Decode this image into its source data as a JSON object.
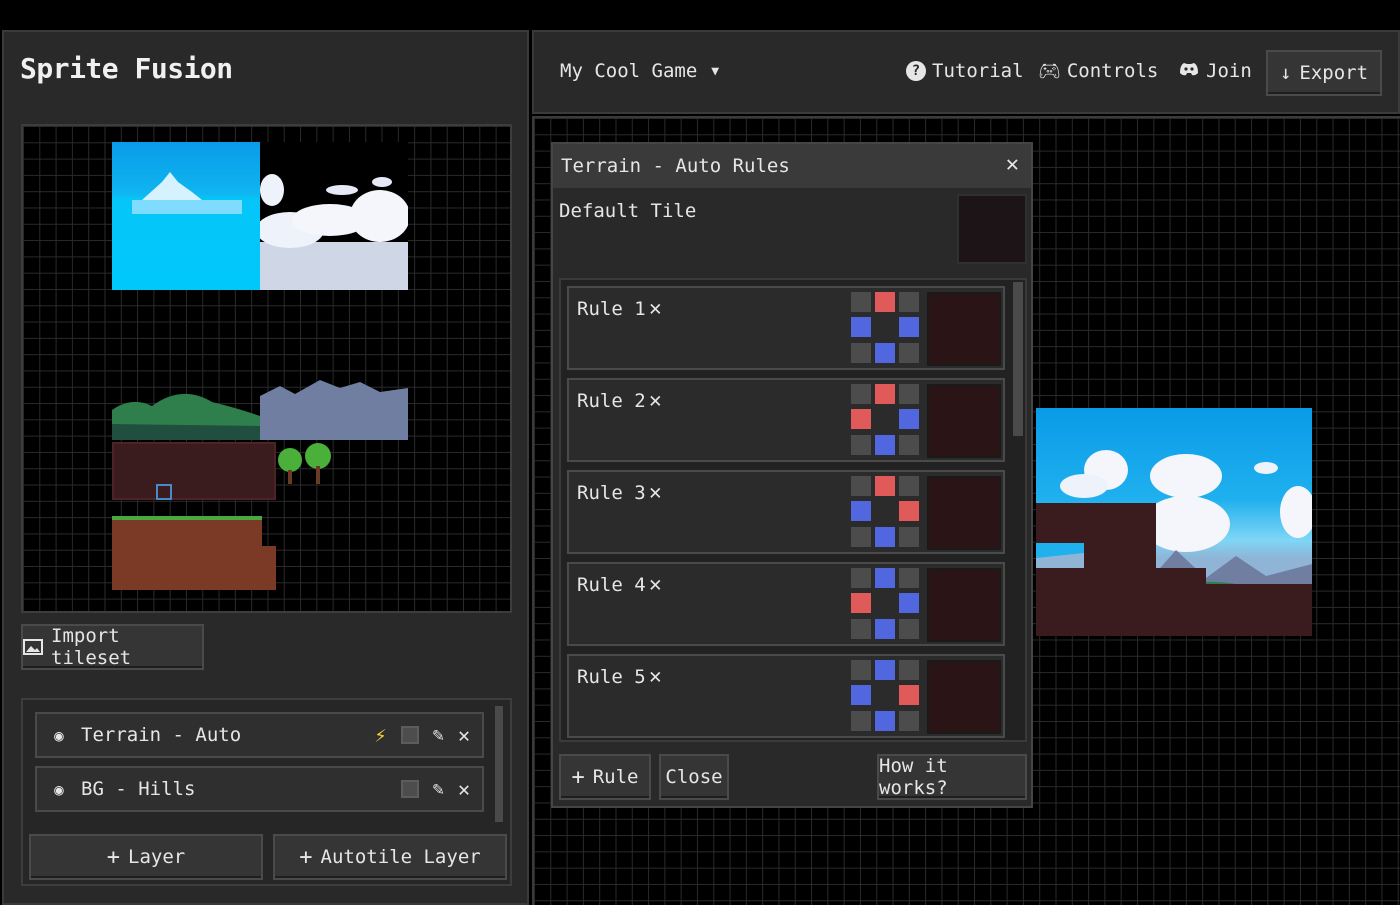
{
  "app": {
    "title": "Sprite Fusion"
  },
  "tileset": {
    "import_label": "Import tileset"
  },
  "layers": {
    "items": [
      {
        "name": "Terrain - Auto",
        "autotile": true
      },
      {
        "name": "BG - Hills",
        "autotile": false
      }
    ],
    "add_layer_label": "Layer",
    "add_autotile_label": "Autotile Layer"
  },
  "topbar": {
    "project_name": "My Cool Game",
    "tutorial_label": "Tutorial",
    "controls_label": "Controls",
    "join_label": "Join",
    "export_label": "Export"
  },
  "rules_modal": {
    "title": "Terrain - Auto Rules",
    "default_tile_label": "Default Tile",
    "rules": [
      {
        "label": "Rule 1",
        "grid": [
          "g",
          "r",
          "g",
          "b",
          "c",
          "b",
          "g",
          "b",
          "g"
        ]
      },
      {
        "label": "Rule 2",
        "grid": [
          "g",
          "r",
          "g",
          "r",
          "c",
          "b",
          "g",
          "b",
          "g"
        ]
      },
      {
        "label": "Rule 3",
        "grid": [
          "g",
          "r",
          "g",
          "b",
          "c",
          "r",
          "g",
          "b",
          "g"
        ]
      },
      {
        "label": "Rule 4",
        "grid": [
          "g",
          "b",
          "g",
          "r",
          "c",
          "b",
          "g",
          "b",
          "g"
        ]
      },
      {
        "label": "Rule 5",
        "grid": [
          "g",
          "b",
          "g",
          "b",
          "c",
          "r",
          "g",
          "b",
          "g"
        ]
      }
    ],
    "add_rule_label": "Rule",
    "close_label": "Close",
    "help_label": "How it works?"
  },
  "colors": {
    "rule_red": "#e05a5a",
    "rule_blue": "#5067e0",
    "panel": "#292929",
    "accent_yellow": "#f5d43a"
  }
}
